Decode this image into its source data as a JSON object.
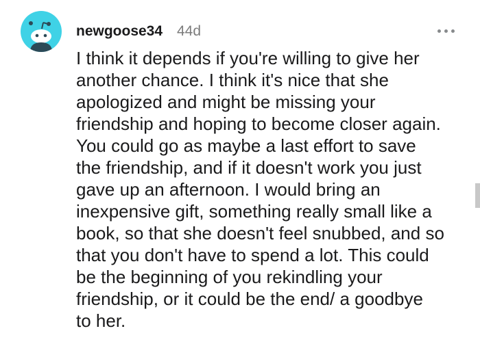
{
  "comment": {
    "username": "newgoose34",
    "timestamp": "44d",
    "more_icon": "more-horizontal-icon",
    "avatar_icon": "snoo-avatar-icon",
    "avatar_color": "#3fd2e6",
    "body_lines": [
      "I think it depends if you're willing to give her",
      "another chance. I think it's nice that she",
      "apologized and might be missing your",
      "friendship and hoping to become closer again.",
      "You could go as maybe a last effort to save",
      "the friendship, and if it doesn't work you just",
      "gave up an afternoon. I would bring an",
      "inexpensive gift, something really small like a",
      "book, so that she doesn't feel snubbed, and so",
      "that you don't have to spend a lot. This could",
      "be the beginning of you rekindling your",
      "friendship, or it could be the end/ a goodbye",
      "to her."
    ]
  }
}
